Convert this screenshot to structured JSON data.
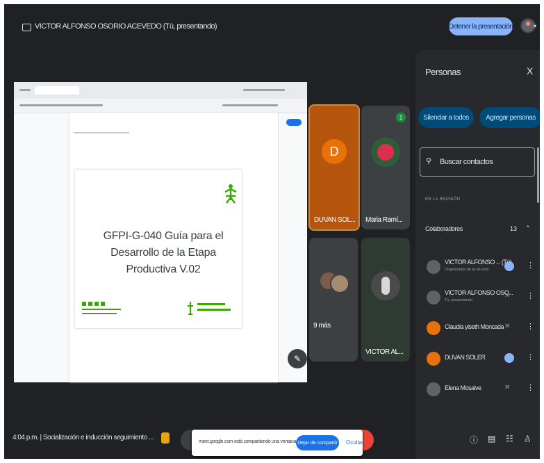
{
  "topbar": {
    "presenter_title": "VICTOR ALFONSO OSORIO ACEVEDO (Tú, presentando)",
    "stop_button": "Detener la presentación"
  },
  "share": {
    "slide_title": "GFPI-G-040 Guía para el Desarrollo de la Etapa Productiva V.02"
  },
  "tiles": [
    {
      "name": "DUVAN SOL...",
      "initial": "D"
    },
    {
      "name": "Maria Ramí...",
      "badge": "1"
    },
    {
      "name": "9 más"
    },
    {
      "name": "VICTOR AL..."
    }
  ],
  "panel": {
    "title": "Personas",
    "close": "X",
    "mute_all": "Silenciar a todos",
    "add_people": "Agregar personas",
    "search_placeholder": "Buscar contactos",
    "section": "EN LA REUNIÓN",
    "group": "Colaboradores",
    "count": "13",
    "people": [
      {
        "name": "VICTOR ALFONSO ... (Tú)",
        "role": "Organizador de la reunión"
      },
      {
        "name": "VICTOR ALFONSO OSO...",
        "role": "Tú, presentando"
      },
      {
        "name": "Claudia yiseth Moncada",
        "role": ""
      },
      {
        "name": "DUVAN SOLER",
        "role": ""
      },
      {
        "name": "Elena Mosalve",
        "role": ""
      }
    ]
  },
  "bottombar": {
    "time_meeting": "4:04 p.m. | Socialización e inducción seguimiento ...",
    "toast_text": "meet.google.com está compartiendo una ventana.",
    "toast_stop": "Dejar de compartir",
    "toast_hide": "Ocultar"
  }
}
